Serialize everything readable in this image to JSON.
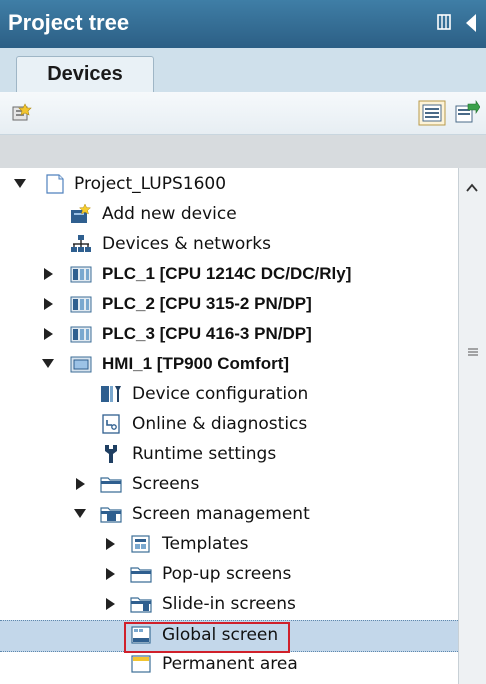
{
  "panel": {
    "title": "Project tree"
  },
  "tabs": [
    "Devices"
  ],
  "tree": {
    "root": "Project_LUPS1600",
    "items": [
      "Add new device",
      "Devices & networks",
      "PLC_1 [CPU 1214C DC/DC/Rly]",
      "PLC_2 [CPU 315-2 PN/DP]",
      "PLC_3 [CPU 416-3 PN/DP]",
      "HMI_1 [TP900 Comfort]",
      "Device configuration",
      "Online & diagnostics",
      "Runtime settings",
      "Screens",
      "Screen management",
      "Templates",
      "Pop-up screens",
      "Slide-in screens",
      "Global screen",
      "Permanent area"
    ],
    "selected": "Global screen"
  },
  "colors": {
    "title_bar": "#2f6b93",
    "selection": "#c3d7ea",
    "highlight_box": "#d0202a"
  }
}
